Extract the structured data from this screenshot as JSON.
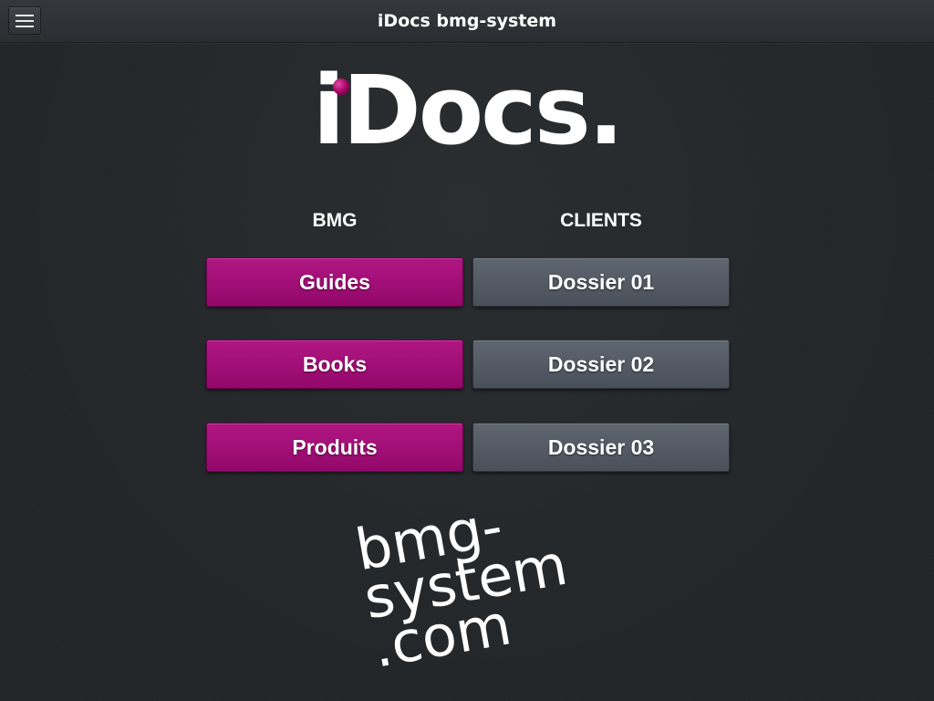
{
  "app": {
    "title": "iDocs bmg-system"
  },
  "header": {
    "menu_icon": "hamburger-menu-icon"
  },
  "logo": {
    "text": "iDocs.",
    "dot_color": "#a0005f"
  },
  "columns": {
    "left_header": "BMG",
    "right_header": "CLIENTS"
  },
  "bmg_buttons": [
    {
      "label": "Guides"
    },
    {
      "label": "Books"
    },
    {
      "label": "Produits"
    }
  ],
  "client_buttons": [
    {
      "label": "Dossier 01"
    },
    {
      "label": "Dossier 02"
    },
    {
      "label": "Dossier 03"
    }
  ],
  "site_logo": {
    "line1": "bmg-",
    "line2": "system",
    "line3": ".com"
  },
  "colors": {
    "accent": "#a0106f",
    "secondary_button": "#545b64",
    "background": "#232629"
  }
}
